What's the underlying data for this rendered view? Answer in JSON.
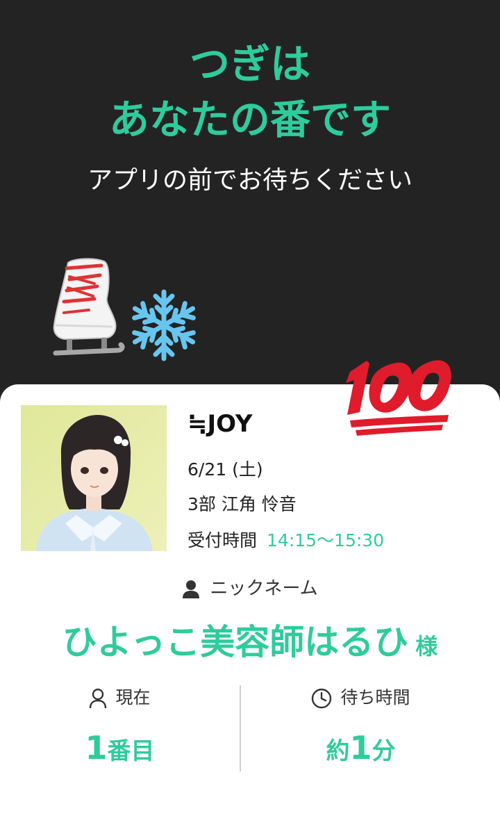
{
  "header": {
    "headline_line1": "つぎは",
    "headline_line2": "あなたの番です",
    "subtext": "アプリの前でお待ちください"
  },
  "decorations": [
    "ice-skate-emoji",
    "snowflake-emoji",
    "hundred-points-emoji"
  ],
  "ticket": {
    "group_name": "≒JOY",
    "date": "6/21 (土)",
    "session_member": "3部  江角 怜音",
    "reception_label": "受付時間",
    "reception_time": "14:15〜15:30",
    "nickname_label": "ニックネーム",
    "nickname": "ひよっこ美容師はるひ",
    "honorific": "様",
    "current": {
      "label": "現在",
      "value": "1",
      "unit": "番目"
    },
    "wait": {
      "label": "待ち時間",
      "prefix": "約",
      "value": "1",
      "unit": "分"
    }
  },
  "colors": {
    "accent": "#2fcc9b",
    "background": "#232323",
    "card": "#ffffff"
  }
}
